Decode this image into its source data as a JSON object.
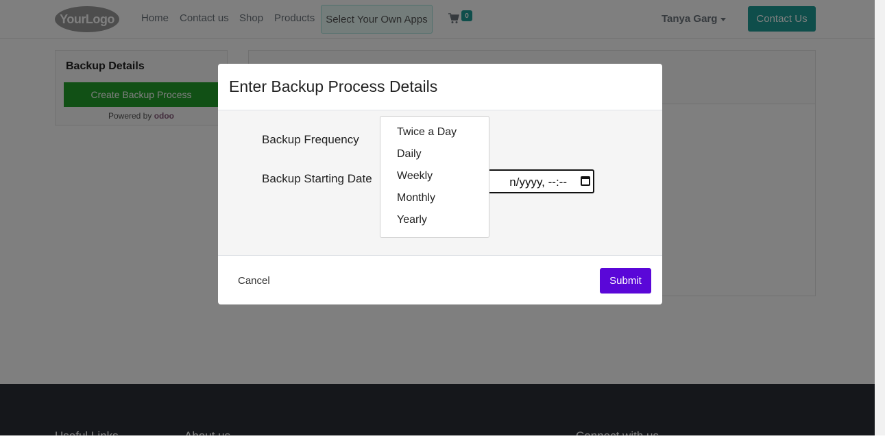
{
  "navbar": {
    "logo_text": "YourLogo",
    "links": [
      "Home",
      "Contact us",
      "Shop",
      "Products"
    ],
    "apps_label": "Select Your Own Apps",
    "cart_icon": "shopping-cart-icon",
    "cart_count": "0",
    "user_name": "Tanya Garg",
    "contact_button": "Contact Us",
    "accent_color": "#1e9c96"
  },
  "sidebar": {
    "title": "Backup Details",
    "create_button": "Create Backup Process",
    "powered_by": "Powered by",
    "powered_brand": "odoo"
  },
  "modal": {
    "title": "Enter Backup Process Details",
    "frequency_label": "Backup Frequency",
    "start_date_label": "Backup Starting Date",
    "start_date_visible_text": "n/yyyy, --:--",
    "frequency_options": [
      "Twice a Day",
      "Daily",
      "Weekly",
      "Monthly",
      "Yearly"
    ],
    "cancel_label": "Cancel",
    "submit_label": "Submit",
    "submit_color": "#5a07d8"
  },
  "footer": {
    "headings": [
      "Useful Links",
      "About us",
      "Connect with us"
    ]
  }
}
